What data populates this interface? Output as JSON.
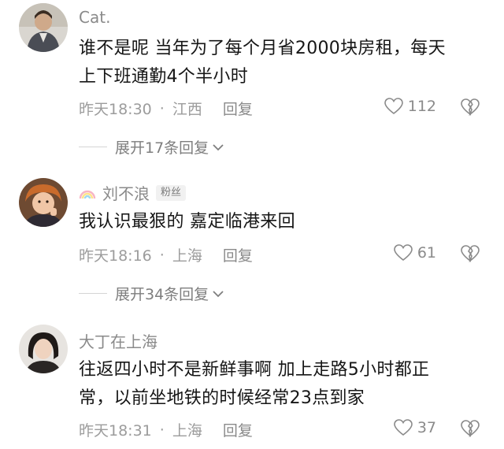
{
  "comments": [
    {
      "username": "Cat.",
      "badge": "",
      "text_line1": "谁不是呢  当年为了每个月省2000块房租，每天",
      "text_line2": "上下班通勤4个半小时",
      "time": "昨天18:30",
      "location": "江西",
      "reply_label": "回复",
      "likes": "112",
      "expand_label": "展开17条回复"
    },
    {
      "username": "刘不浪",
      "badge": "粉丝",
      "text_line1": "我认识最狠的 嘉定临港来回",
      "text_line2": "",
      "time": "昨天18:16",
      "location": "上海",
      "reply_label": "回复",
      "likes": "61",
      "expand_label": "展开34条回复"
    },
    {
      "username": "大丁在上海",
      "badge": "",
      "text_line1": "往返四小时不是新鲜事啊 加上走路5小时都正",
      "text_line2": "常，以前坐地铁的时候经常23点到家",
      "time": "昨天18:31",
      "location": "上海",
      "reply_label": "回复",
      "likes": "37",
      "expand_label": ""
    }
  ],
  "separator": "·",
  "icons": {
    "like": "heart-outline-icon",
    "dislike": "broken-heart-icon",
    "expand": "chevron-down-icon",
    "badge_prefix": "rainbow-icon"
  }
}
